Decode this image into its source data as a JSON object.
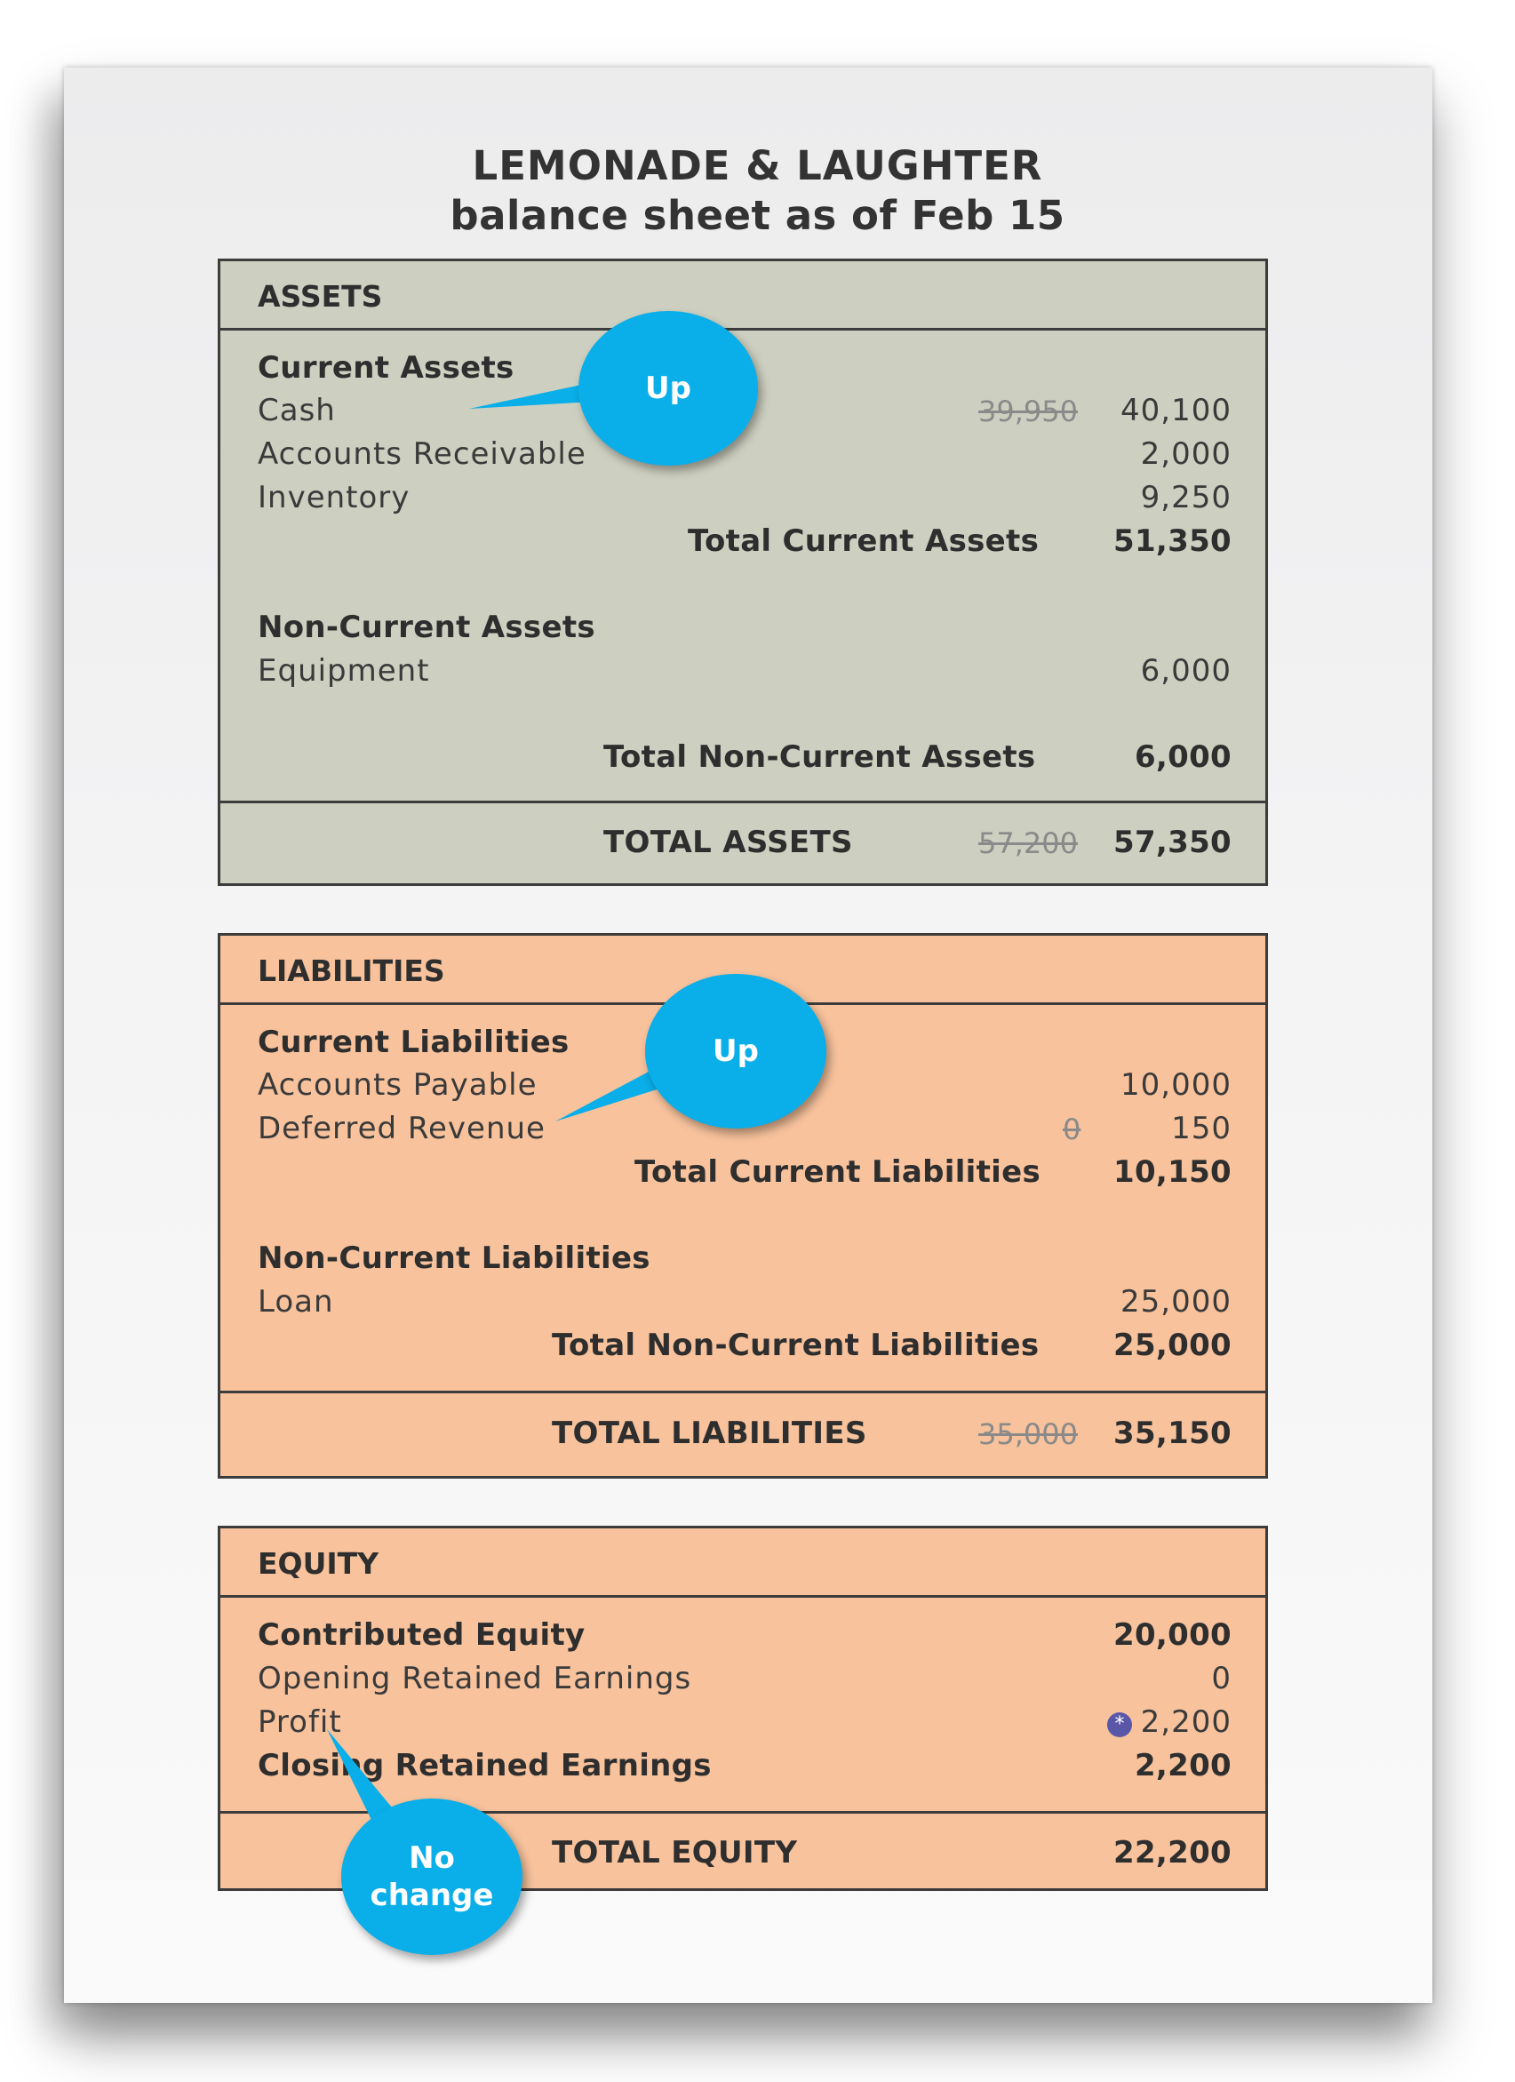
{
  "title": {
    "line1": "LEMONADE & LAUGHTER",
    "line2": "balance sheet as of Feb 15"
  },
  "assets": {
    "header": "ASSETS",
    "current_heading": "Current Assets",
    "cash_label": "Cash",
    "cash_old": "39,950",
    "cash_value": "40,100",
    "ar_label": "Accounts Receivable",
    "ar_value": "2,000",
    "inventory_label": "Inventory",
    "inventory_value": "9,250",
    "total_current_label": "Total Current Assets",
    "total_current_value": "51,350",
    "noncurrent_heading": "Non-Current Assets",
    "equipment_label": "Equipment",
    "equipment_value": "6,000",
    "total_noncurrent_label": "Total Non-Current Assets",
    "total_noncurrent_value": "6,000",
    "total_label": "TOTAL ASSETS",
    "total_old": "57,200",
    "total_value": "57,350"
  },
  "liabilities": {
    "header": "LIABILITIES",
    "current_heading": "Current Liabilities",
    "ap_label": "Accounts Payable",
    "ap_value": "10,000",
    "deferred_label": "Deferred Revenue",
    "deferred_old": "0",
    "deferred_value": "150",
    "total_current_label": "Total Current Liabilities",
    "total_current_value": "10,150",
    "noncurrent_heading": "Non-Current Liabilities",
    "loan_label": "Loan",
    "loan_value": "25,000",
    "total_noncurrent_label": "Total Non-Current Liabilities",
    "total_noncurrent_value": "25,000",
    "total_label": "TOTAL LIABILITIES",
    "total_old": "35,000",
    "total_value": "35,150"
  },
  "equity": {
    "header": "EQUITY",
    "contributed_label": "Contributed Equity",
    "contributed_value": "20,000",
    "opening_re_label": "Opening Retained Earnings",
    "opening_re_value": "0",
    "profit_label": "Profit",
    "profit_marker": "*",
    "profit_value": "2,200",
    "closing_re_label": "Closing Retained Earnings",
    "closing_re_value": "2,200",
    "total_label": "TOTAL EQUITY",
    "total_value": "22,200"
  },
  "callouts": {
    "cash": "Up",
    "deferred_revenue": "Up",
    "profit_line1": "No",
    "profit_line2": "change"
  },
  "colors": {
    "assets_bg": "#cdd0c0",
    "liabilities_bg": "#f7c29c",
    "equity_bg": "#f7c29c",
    "callout": "#0aaee8",
    "marker": "#5a57a8"
  }
}
